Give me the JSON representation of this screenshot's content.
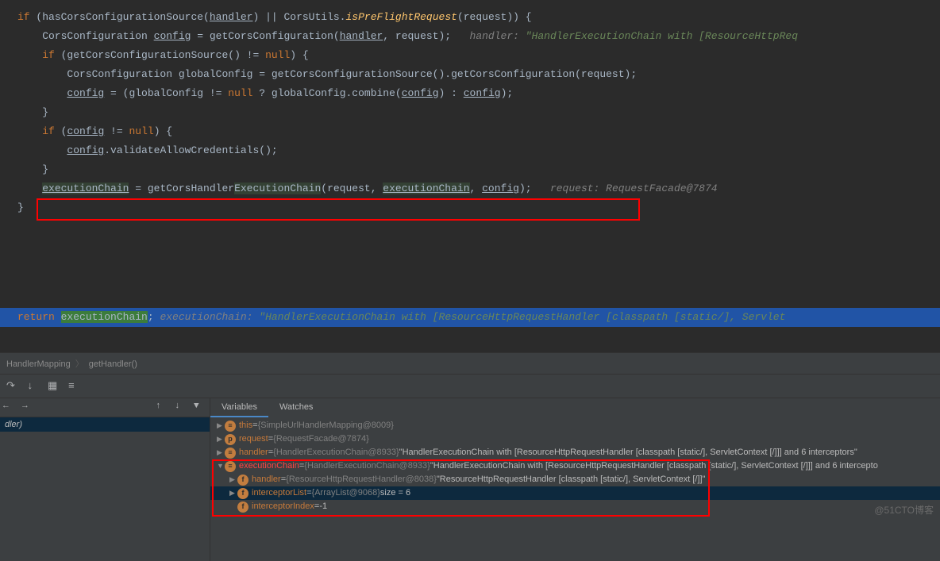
{
  "code": {
    "l1a": "if",
    "l1b": " (hasCorsConfigurationSource(",
    "l1c": "handler",
    "l1d": ") || CorsUtils.",
    "l1e": "isPreFlightRequest",
    "l1f": "(request)) {",
    "l2a": "    CorsConfiguration ",
    "l2b": "config",
    "l2c": " = getCorsConfiguration(",
    "l2d": "handler",
    "l2e": ", request);   ",
    "l2f": "handler: ",
    "l2g": "\"HandlerExecutionChain with [ResourceHttpReq",
    "l3a": "    ",
    "l3b": "if",
    "l3c": " (getCorsConfigurationSource() != ",
    "l3d": "null",
    "l3e": ") {",
    "l4": "        CorsConfiguration globalConfig = getCorsConfigurationSource().getCorsConfiguration(request);",
    "l5a": "        ",
    "l5b": "config",
    "l5c": " = (globalConfig != ",
    "l5d": "null",
    "l5e": " ? globalConfig.combine(",
    "l5f": "config",
    "l5g": ") : ",
    "l5h": "config",
    "l5i": ");",
    "l6": "    }",
    "l7a": "    ",
    "l7b": "if",
    "l7c": " (",
    "l7d": "config",
    "l7e": " != ",
    "l7f": "null",
    "l7g": ") {",
    "l8a": "        ",
    "l8b": "config",
    "l8c": ".validateAllowCredentials();",
    "l9": "    }",
    "l10a": "    ",
    "l10b": "executionChain",
    "l10c": " = getCorsHandler",
    "l10d": "ExecutionChain",
    "l10e": "(request, ",
    "l10f": "executionChain",
    "l10g": ", ",
    "l10h": "config",
    "l10i": ");   ",
    "l10j": "request: RequestFacade@7874",
    "l11": "}",
    "ret": "return",
    "retvar": "executionChain",
    "retsemi": ";   ",
    "retcomment": "executionChain: ",
    "retval": "\"HandlerExecutionChain with [ResourceHttpRequestHandler [classpath [static/], Servlet"
  },
  "breadcrumb": {
    "class": "HandlerMapping",
    "method": "getHandler()"
  },
  "tabs": {
    "variables": "Variables",
    "watches": "Watches"
  },
  "frame": {
    "text": "dler)"
  },
  "vars": {
    "v1name": "this",
    "v1eq": " = ",
    "v1type": "{SimpleUrlHandlerMapping@8009}",
    "v2name": "request",
    "v2eq": " = ",
    "v2type": "{RequestFacade@7874}",
    "v3name": "handler",
    "v3eq": " = ",
    "v3type": "{HandlerExecutionChain@8933} ",
    "v3val": "\"HandlerExecutionChain with [ResourceHttpRequestHandler [classpath [static/], ServletContext [/]]] and 6 interceptors\"",
    "v4name": "executionChain",
    "v4eq": " = ",
    "v4type": "{HandlerExecutionChain@8933} ",
    "v4val": "\"HandlerExecutionChain with [ResourceHttpRequestHandler [classpath [static/], ServletContext [/]]] and 6 intercepto",
    "v5name": "handler",
    "v5eq": " = ",
    "v5type": "{ResourceHttpRequestHandler@8038} ",
    "v5val": "\"ResourceHttpRequestHandler [classpath [static/], ServletContext [/]]\"",
    "v6name": "interceptorList",
    "v6eq": " = ",
    "v6type": "{ArrayList@9068}  ",
    "v6val": "size = 6",
    "v7name": "interceptorIndex",
    "v7eq": " = ",
    "v7val": "-1"
  },
  "watermark": "@51CTO博客"
}
